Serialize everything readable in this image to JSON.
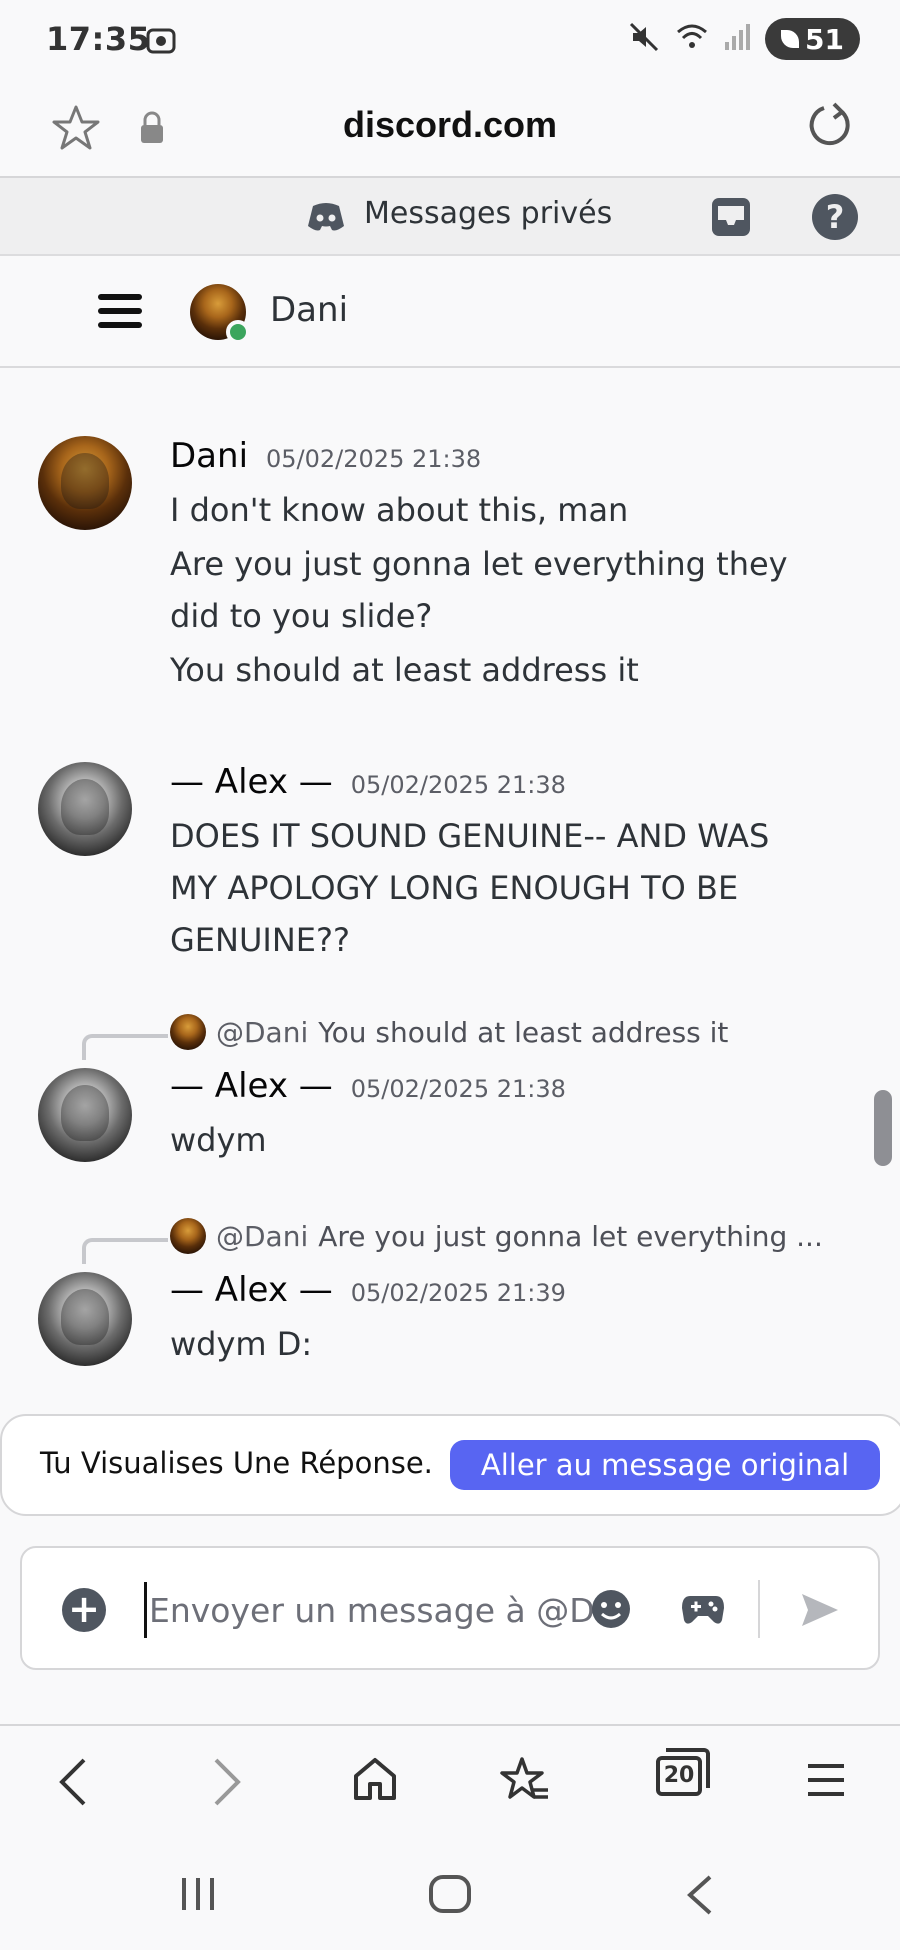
{
  "status_bar": {
    "time": "17:35",
    "battery": "51"
  },
  "browser": {
    "url": "discord.com"
  },
  "discord_top": {
    "section_title": "Messages privés",
    "help_symbol": "?"
  },
  "channel": {
    "name": "Dani"
  },
  "messages": [
    {
      "author": "Dani",
      "timestamp": "05/02/2025 21:38",
      "lines": [
        "I don't know about this, man",
        "Are you just gonna let everything they did to you slide?",
        "You should at least address it"
      ]
    },
    {
      "author": "— Alex —",
      "timestamp": "05/02/2025 21:38",
      "lines": [
        "DOES IT SOUND GENUINE-- AND WAS MY APOLOGY LONG ENOUGH TO BE GENUINE??"
      ]
    },
    {
      "reply_to": {
        "mention": "@Dani",
        "snippet": "You should at least address it"
      },
      "author": "— Alex —",
      "timestamp": "05/02/2025 21:38",
      "lines": [
        "wdym"
      ]
    },
    {
      "reply_to": {
        "mention": "@Dani",
        "snippet": "Are you just gonna let everything ..."
      },
      "author": "— Alex —",
      "timestamp": "05/02/2025 21:39",
      "lines": [
        "wdym D:"
      ]
    }
  ],
  "reply_banner": {
    "text": "Tu Visualises Une Réponse.",
    "button": "Aller au message original"
  },
  "composer": {
    "placeholder": "Envoyer un message à @Dani"
  },
  "toolbar": {
    "tab_count": "20"
  },
  "colors": {
    "accent": "#5865f2",
    "online": "#3ba55d"
  }
}
